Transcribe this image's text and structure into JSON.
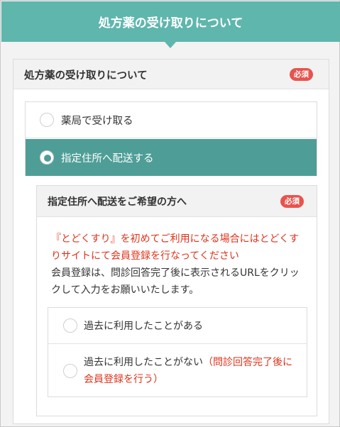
{
  "header": {
    "title": "処方薬の受け取りについて"
  },
  "card": {
    "title": "処方薬の受け取りについて",
    "required_badge": "必須",
    "options": [
      {
        "label": "薬局で受け取る",
        "selected": false
      },
      {
        "label": "指定住所へ配送する",
        "selected": true
      }
    ]
  },
  "delivery": {
    "title": "指定住所へ配送をご希望の方へ",
    "required_badge": "必須",
    "notice_red": "『とどくすり』を初めてご利用になる場合にはとどくすりサイトにて会員登録を行なってください",
    "notice_dark": "会員登録は、問診回答完了後に表示されるURLをクリックして入力をお願いいたします。",
    "options": [
      {
        "label": "過去に利用したことがある",
        "selected": false
      },
      {
        "label": "過去に利用したことがない",
        "label_red": "（問診回答完了後に会員登録を行う）",
        "selected": false
      }
    ]
  },
  "colors": {
    "header_bg": "#5fb6ad",
    "selected_row_bg": "#4e9e97",
    "badge_bg": "#e8534d",
    "notice_red": "#e0321a"
  }
}
